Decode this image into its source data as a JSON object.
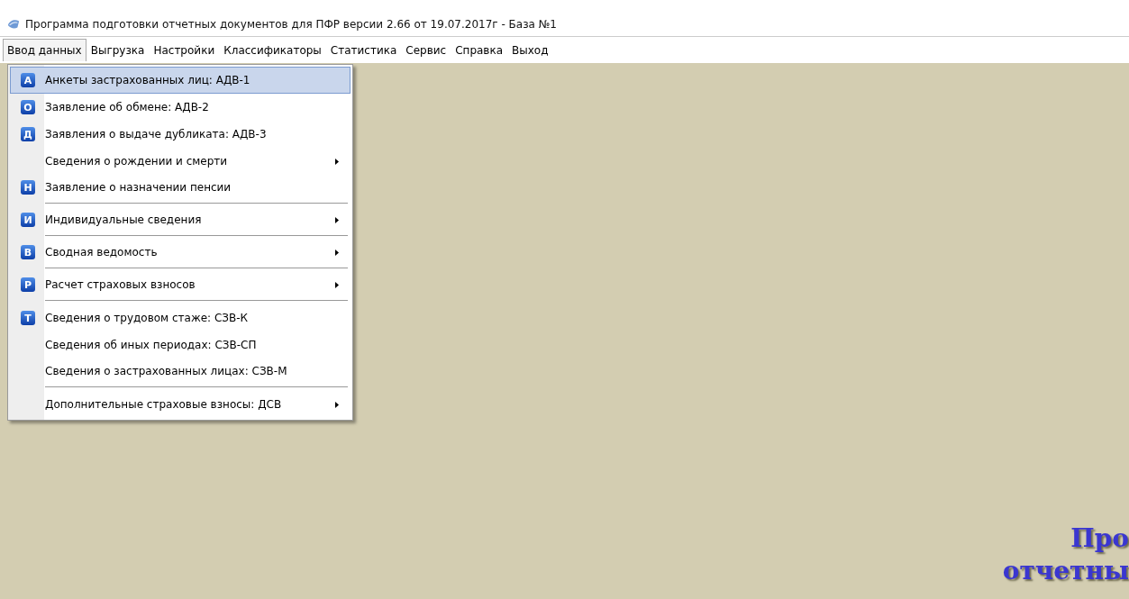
{
  "window": {
    "title": "Программа подготовки отчетных документов для ПФР версии 2.66 от 19.07.2017г - База №1"
  },
  "menu_bar": [
    {
      "label": "Ввод данных",
      "selected": true
    },
    {
      "label": "Выгрузка",
      "selected": false
    },
    {
      "label": "Настройки",
      "selected": false
    },
    {
      "label": "Классификаторы",
      "selected": false
    },
    {
      "label": "Статистика",
      "selected": false
    },
    {
      "label": "Сервис",
      "selected": false
    },
    {
      "label": "Справка",
      "selected": false
    },
    {
      "label": "Выход",
      "selected": false
    }
  ],
  "dropdown": [
    {
      "icon": "А",
      "label": "Анкеты застрахованных лиц: АДВ-1",
      "selected": true,
      "submenu": false,
      "separator_after": false
    },
    {
      "icon": "О",
      "label": "Заявление об обмене: АДВ-2",
      "selected": false,
      "submenu": false,
      "separator_after": false
    },
    {
      "icon": "Д",
      "label": "Заявления о выдаче дубликата: АДВ-3",
      "selected": false,
      "submenu": false,
      "separator_after": false
    },
    {
      "label": "Сведения о рождении и смерти",
      "selected": false,
      "submenu": true,
      "separator_after": false
    },
    {
      "icon": "Н",
      "label": "Заявление о назначении пенсии",
      "selected": false,
      "submenu": false,
      "separator_after": true
    },
    {
      "icon": "И",
      "label": "Индивидуальные сведения",
      "selected": false,
      "submenu": true,
      "separator_after": true
    },
    {
      "icon": "В",
      "label": "Сводная ведомость",
      "selected": false,
      "submenu": true,
      "separator_after": true
    },
    {
      "icon": "Р",
      "label": "Расчет страховых взносов",
      "selected": false,
      "submenu": true,
      "separator_after": true
    },
    {
      "icon": "Т",
      "label": "Сведения о трудовом стаже: СЗВ-К",
      "selected": false,
      "submenu": false,
      "separator_after": false
    },
    {
      "label": "Сведения об иных периодах: СЗВ-СП",
      "selected": false,
      "submenu": false,
      "separator_after": false
    },
    {
      "label": "Сведения о застрахованных лицах: СЗВ-М",
      "selected": false,
      "submenu": false,
      "separator_after": true
    },
    {
      "label": "Дополнительные страховые взносы: ДСВ",
      "selected": false,
      "submenu": true,
      "separator_after": false
    }
  ],
  "banner": [
    "Про",
    "отчетны"
  ]
}
